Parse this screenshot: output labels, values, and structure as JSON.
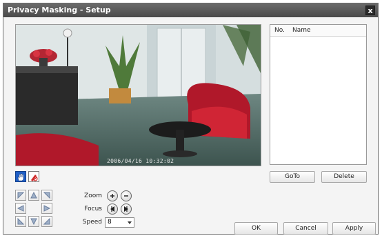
{
  "window": {
    "title": "Privacy Masking - Setup",
    "close_glyph": "x"
  },
  "video": {
    "timestamp": "2006/04/16 10:32:02"
  },
  "tools": [
    {
      "icon": "hand-icon",
      "active": true
    },
    {
      "icon": "pen-erase-icon",
      "active": false
    }
  ],
  "mask_list": {
    "columns": [
      "No.",
      "Name"
    ],
    "rows": []
  },
  "list_buttons": {
    "goto": "GoTo",
    "delete": "Delete"
  },
  "controls": {
    "zoom_label": "Zoom",
    "focus_label": "Focus",
    "speed_label": "Speed",
    "speed_value": "8"
  },
  "footer": {
    "ok": "OK",
    "cancel": "Cancel",
    "apply": "Apply"
  },
  "colors": {
    "accent_blue": "#1f5fc6",
    "title_bg": "#555555",
    "ptz_arrow": "#6b7f9e"
  }
}
